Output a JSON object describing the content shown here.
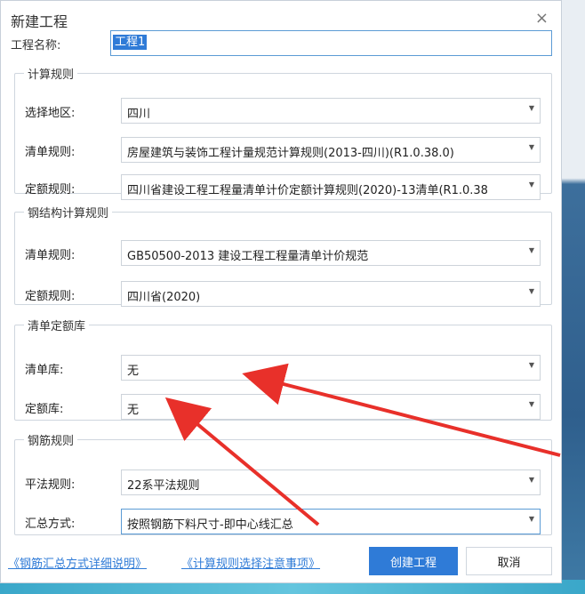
{
  "dialog": {
    "title": "新建工程",
    "close_glyph": "×"
  },
  "project": {
    "label": "工程名称:",
    "value": "工程1"
  },
  "calc_rules": {
    "legend": "计算规则",
    "region": {
      "label": "选择地区:",
      "value": "四川"
    },
    "list_rule": {
      "label": "清单规则:",
      "value": "房屋建筑与装饰工程计量规范计算规则(2013-四川)(R1.0.38.0)"
    },
    "quota_rule": {
      "label": "定额规则:",
      "value": "四川省建设工程工程量清单计价定额计算规则(2020)-13清单(R1.0.38"
    }
  },
  "steel_rules": {
    "legend": "钢结构计算规则",
    "list_rule": {
      "label": "清单规则:",
      "value": "GB50500-2013 建设工程工程量清单计价规范"
    },
    "quota_rule": {
      "label": "定额规则:",
      "value": "四川省(2020)"
    }
  },
  "library": {
    "legend": "清单定额库",
    "list_lib": {
      "label": "清单库:",
      "value": "无"
    },
    "quota_lib": {
      "label": "定额库:",
      "value": "无"
    }
  },
  "rebar_rules": {
    "legend": "钢筋规则",
    "flat_rule": {
      "label": "平法规则:",
      "value": "22系平法规则"
    },
    "summary": {
      "label": "汇总方式:",
      "value": "按照钢筋下料尺寸-即中心线汇总"
    }
  },
  "links": {
    "summary_help": "《钢筋汇总方式详细说明》",
    "rule_help": "《计算规则选择注意事项》"
  },
  "buttons": {
    "create": "创建工程",
    "cancel": "取消"
  },
  "annotation_color": "#e8302a"
}
